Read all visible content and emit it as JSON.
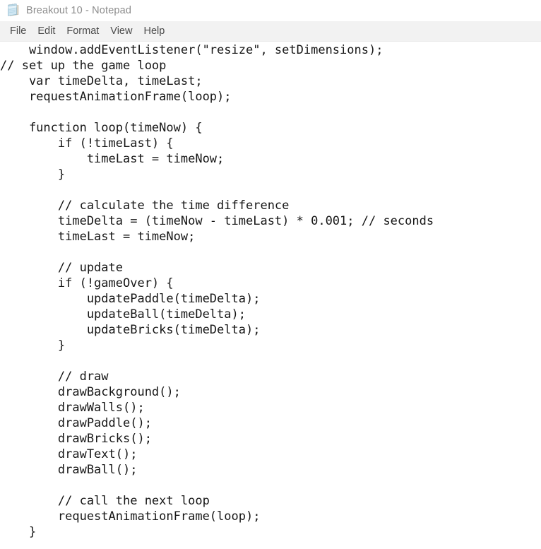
{
  "window": {
    "title": "Breakout 10 - Notepad",
    "icon": "notepad-icon"
  },
  "menubar": {
    "items": [
      {
        "label": "File"
      },
      {
        "label": "Edit"
      },
      {
        "label": "Format"
      },
      {
        "label": "View"
      },
      {
        "label": "Help"
      }
    ]
  },
  "editor": {
    "language": "javascript",
    "lines": [
      "    window.addEventListener(\"resize\", setDimensions);",
      "// set up the game loop",
      "    var timeDelta, timeLast;",
      "    requestAnimationFrame(loop);",
      "",
      "    function loop(timeNow) {",
      "        if (!timeLast) {",
      "            timeLast = timeNow;",
      "        }",
      "",
      "        // calculate the time difference",
      "        timeDelta = (timeNow - timeLast) * 0.001; // seconds",
      "        timeLast = timeNow;",
      "",
      "        // update",
      "        if (!gameOver) {",
      "            updatePaddle(timeDelta);",
      "            updateBall(timeDelta);",
      "            updateBricks(timeDelta);",
      "        }",
      "",
      "        // draw",
      "        drawBackground();",
      "        drawWalls();",
      "        drawPaddle();",
      "        drawBricks();",
      "        drawText();",
      "        drawBall();",
      "",
      "        // call the next loop",
      "        requestAnimationFrame(loop);",
      "    }"
    ]
  },
  "colors": {
    "titlebar_bg": "#ffffff",
    "title_text": "#8d8d8d",
    "menubar_bg": "#f2f2f2",
    "menu_text": "#4a4a4a",
    "editor_bg": "#ffffff",
    "code_text": "#171717"
  }
}
